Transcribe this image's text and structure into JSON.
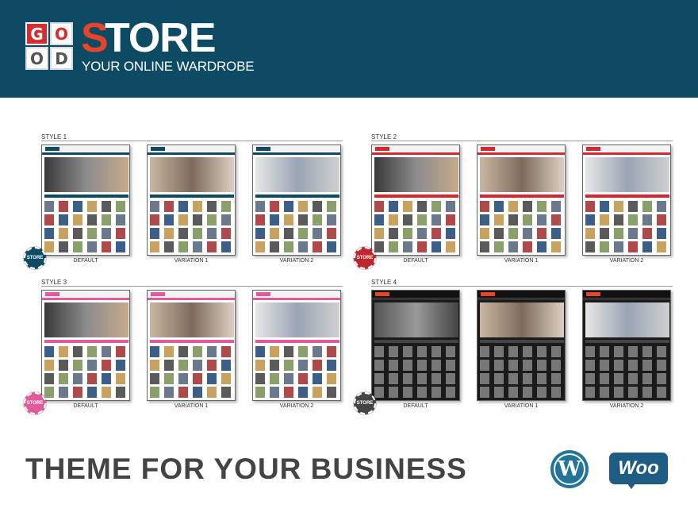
{
  "brand": {
    "logo_letters": [
      "G",
      "O",
      "O",
      "D"
    ],
    "name_first": "S",
    "name_rest": "TORE",
    "tagline": "YOUR ONLINE WARDROBE"
  },
  "colors": {
    "header_bg": "#0d4a63",
    "brand_red": "#e8432b",
    "style1_accent": "#0d4a63",
    "style2_accent": "#d7262e",
    "style3_accent": "#e25a9c",
    "style4_accent": "#222222"
  },
  "badge_label": "STORE",
  "groups": [
    {
      "title": "STYLE 1",
      "thumbs": [
        "DEFAULT",
        "VARIATION 1",
        "VARIATION 2"
      ],
      "accent": "#0d4a63",
      "badge": "#0d4a63",
      "dark": false
    },
    {
      "title": "STYLE 2",
      "thumbs": [
        "DEFAULT",
        "VARIATION 1",
        "VARIATION 2"
      ],
      "accent": "#d7262e",
      "badge": "#c0262e",
      "dark": false
    },
    {
      "title": "STYLE 3",
      "thumbs": [
        "DEFAULT",
        "VARIATION 1",
        "VARIATION 2"
      ],
      "accent": "#e25a9c",
      "badge": "#e25a9c",
      "dark": false
    },
    {
      "title": "STYLE 4",
      "thumbs": [
        "DEFAULT",
        "VARIATION 1",
        "VARIATION 2"
      ],
      "accent": "#e8432b",
      "badge": "#444444",
      "dark": true
    }
  ],
  "footer": {
    "headline": "THEME FOR YOUR BUSINESS",
    "wordpress_icon": "wordpress-logo",
    "wordpress_glyph": "W",
    "woo_icon": "woocommerce-logo",
    "woo_text": "Woo"
  }
}
